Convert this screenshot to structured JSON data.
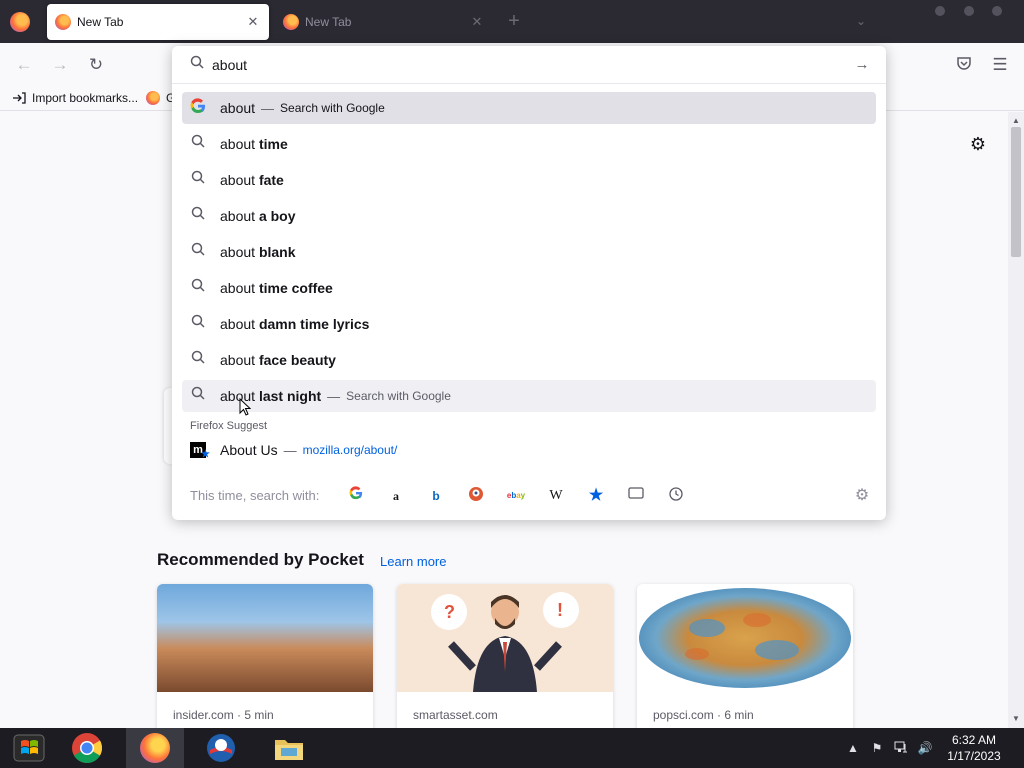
{
  "tabs": [
    {
      "title": "New Tab",
      "active": true
    },
    {
      "title": "New Tab",
      "active": false
    }
  ],
  "navbar": {
    "back_icon": "back-arrow-icon",
    "forward_icon": "forward-arrow-icon",
    "reload_icon": "reload-icon",
    "pocket_icon": "pocket-icon",
    "menu_icon": "hamburger-menu-icon"
  },
  "bookmarks": {
    "import_label": "Import bookmarks...",
    "getting_started_label": "Ge"
  },
  "urlbar": {
    "value": "about"
  },
  "suggestions": [
    {
      "prefix": "about",
      "bold": "",
      "sep": "—",
      "action": "Search with Google",
      "icon": "google-icon",
      "selected": true
    },
    {
      "prefix": "about",
      "bold": "time",
      "icon": "search-icon"
    },
    {
      "prefix": "about",
      "bold": "fate",
      "icon": "search-icon"
    },
    {
      "prefix": "about",
      "bold": "a boy",
      "icon": "search-icon"
    },
    {
      "prefix": "about",
      "bold": "blank",
      "icon": "search-icon"
    },
    {
      "prefix": "about",
      "bold": "time coffee",
      "icon": "search-icon"
    },
    {
      "prefix": "about",
      "bold": "damn time lyrics",
      "icon": "search-icon"
    },
    {
      "prefix": "about",
      "bold": "face beauty",
      "icon": "search-icon"
    },
    {
      "prefix": "about",
      "bold": "last night",
      "sep": "—",
      "action": "Search with Google",
      "icon": "search-icon",
      "hover": true
    }
  ],
  "firefox_suggest": {
    "group_label": "Firefox Suggest",
    "title": "About Us",
    "sep": "—",
    "url": "mozilla.org/about/"
  },
  "oneoff": {
    "label": "This time, search with:",
    "engines": [
      "google-icon",
      "amazon-icon",
      "bing-icon",
      "duckduckgo-icon",
      "ebay-icon",
      "wikipedia-icon",
      "bookmarks-star-icon",
      "tabs-icon",
      "history-icon"
    ]
  },
  "pocket": {
    "title": "Recommended by Pocket",
    "learn_more": "Learn more",
    "cards": [
      {
        "source": "insider.com · 5 min"
      },
      {
        "source": "smartasset.com"
      },
      {
        "source": "popsci.com · 6 min"
      }
    ]
  },
  "taskbar": {
    "time": "6:32 AM",
    "date": "1/17/2023"
  },
  "colors": {
    "accent": "#0061e0",
    "tabstrip": "#2b2a33",
    "taskbar": "#1c1c22"
  }
}
